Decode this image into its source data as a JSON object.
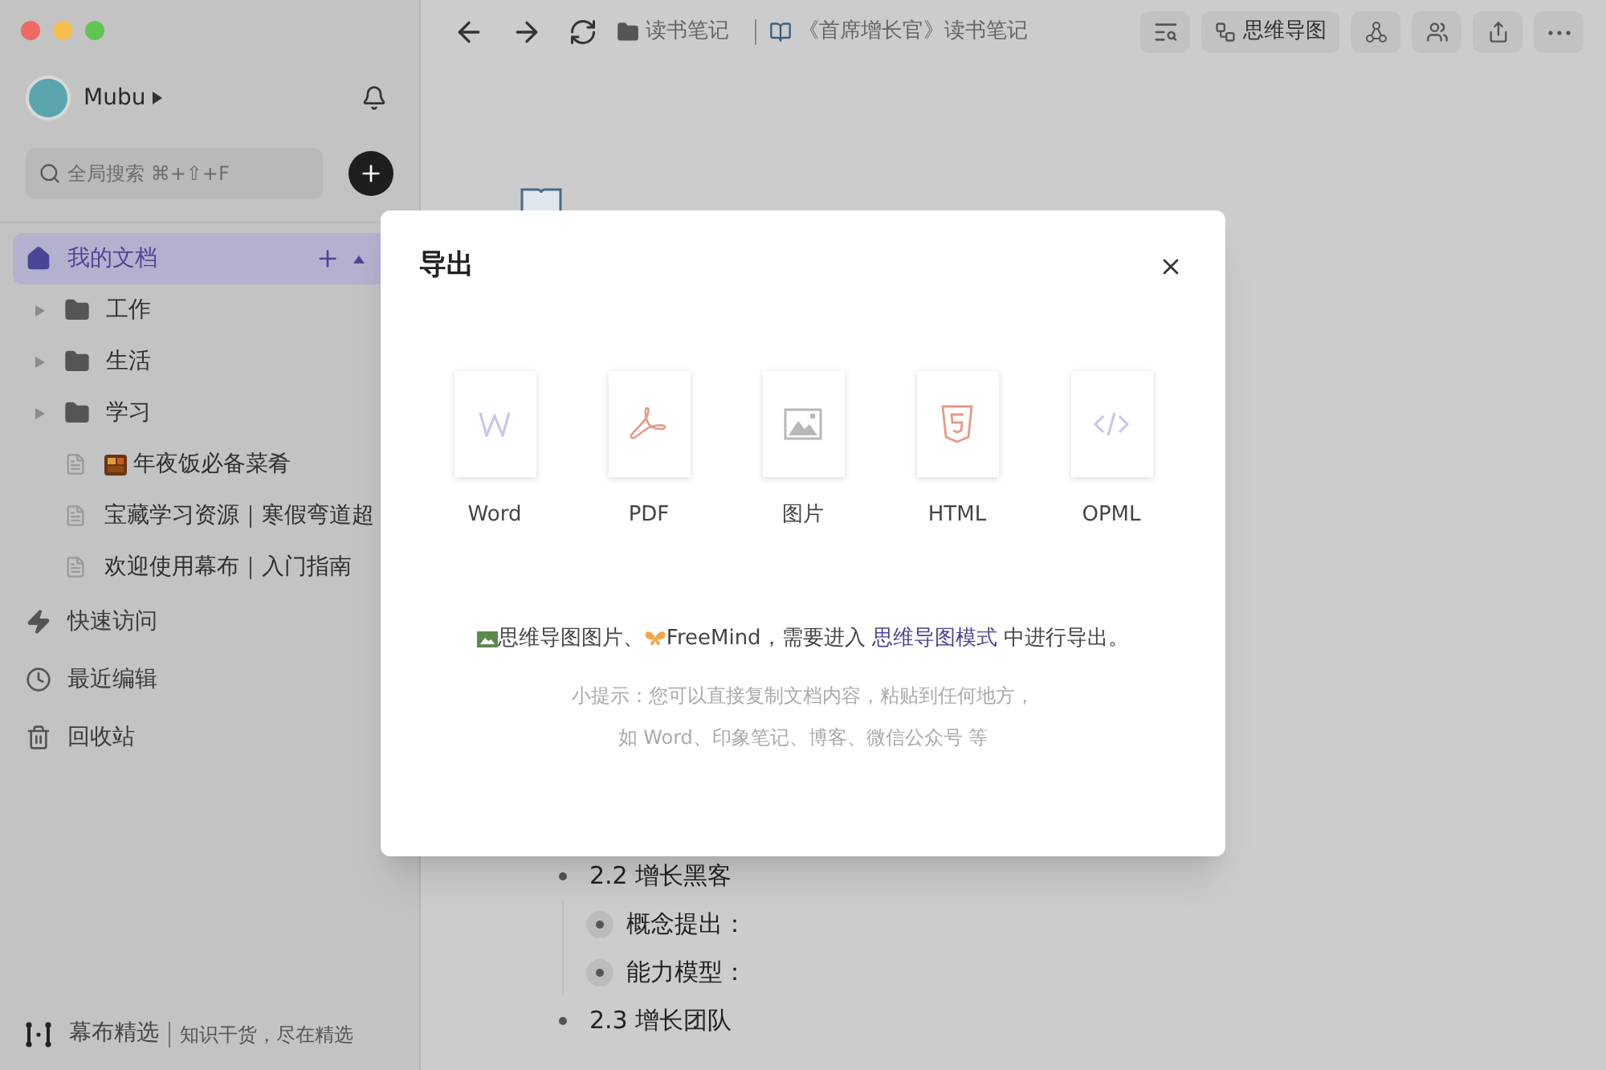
{
  "sidebar": {
    "user": {
      "name": "Mubu"
    },
    "search": {
      "placeholder": "全局搜索 ⌘+⇧+F"
    },
    "root": {
      "label": "我的文档",
      "selected": true,
      "expanded": true,
      "children": [
        {
          "kind": "folder",
          "label": "工作",
          "expanded": false
        },
        {
          "kind": "folder",
          "label": "生活",
          "expanded": false
        },
        {
          "kind": "folder",
          "label": "学习",
          "expanded": false
        },
        {
          "kind": "doc",
          "label": "年夜饭必备菜肴",
          "emoji": true
        },
        {
          "kind": "doc",
          "label": "宝藏学习资源｜寒假弯道超",
          "emoji": false
        },
        {
          "kind": "doc",
          "label": "欢迎使用幕布｜入门指南",
          "emoji": false
        }
      ]
    },
    "nav": [
      {
        "kind": "quick",
        "label": "快速访问"
      },
      {
        "kind": "recent",
        "label": "最近编辑"
      },
      {
        "kind": "trash",
        "label": "回收站"
      }
    ],
    "footer": {
      "title": "幕布精选",
      "subtitle": "知识干货，尽在精选"
    }
  },
  "toolbar": {
    "folder": "读书笔记",
    "document": "《首席增长官》读书笔记",
    "mindmap_button": "思维导图"
  },
  "document": {
    "outline": [
      {
        "text": "2.2 增长黑客",
        "children": [
          {
            "text": "概念提出："
          },
          {
            "text": "能力模型："
          }
        ]
      },
      {
        "text": "2.3 增长团队"
      }
    ]
  },
  "dialog": {
    "title": "导出",
    "formats": [
      {
        "kind": "word",
        "label": "Word"
      },
      {
        "kind": "pdf",
        "label": "PDF"
      },
      {
        "kind": "image",
        "label": "图片"
      },
      {
        "kind": "html",
        "label": "HTML"
      },
      {
        "kind": "opml",
        "label": "OPML"
      }
    ],
    "note": {
      "image_label": "思维导图图片、",
      "text_before": "FreeMind，需要进入 ",
      "link": "思维导图模式",
      "text_after": " 中进行导出。"
    },
    "tips": [
      "小提示：您可以直接复制文档内容，粘贴到任何地方，",
      "如 Word、印象笔记、博客、微信公众号 等"
    ]
  }
}
